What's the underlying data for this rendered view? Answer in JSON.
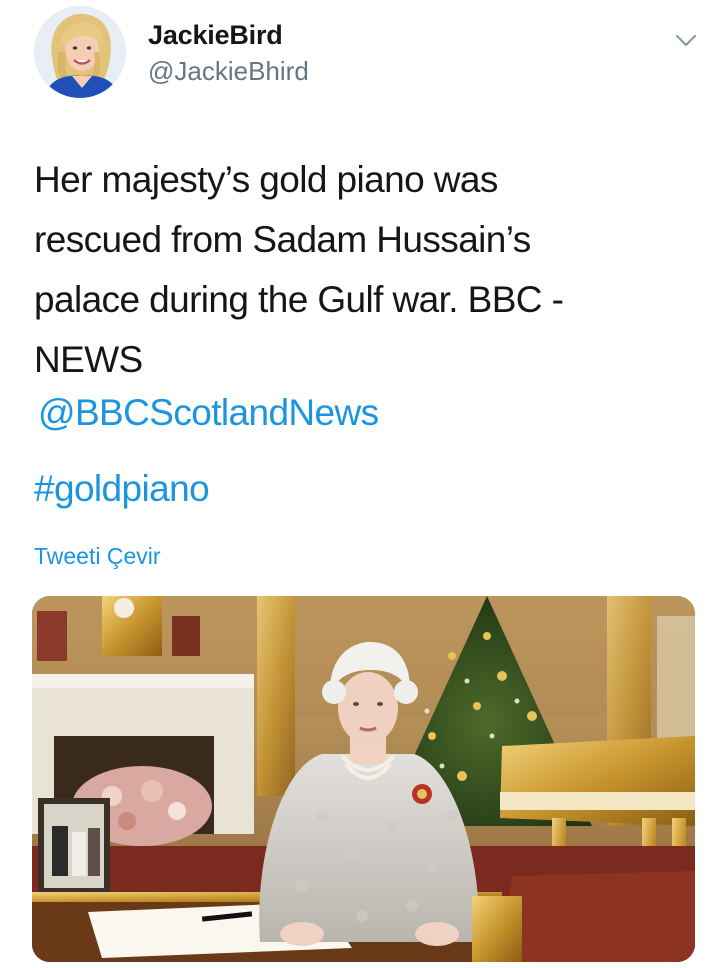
{
  "tweet": {
    "author": {
      "display_name": "JackieBird",
      "handle": "@JackieBhird"
    },
    "text_lines": [
      "Her majesty’s gold piano was",
      "rescued from Sadam Hussain’s",
      "palace during the Gulf war. BBC -",
      "NEWS"
    ],
    "mention": "@BBCScotlandNews",
    "hashtag": "#goldpiano",
    "translate_label": "Tweeti Çevir"
  },
  "colors": {
    "link_blue": "#1b95e0",
    "text_primary": "#14171a",
    "text_secondary": "#657786"
  },
  "icons": {
    "menu": "chevron-down-icon"
  }
}
